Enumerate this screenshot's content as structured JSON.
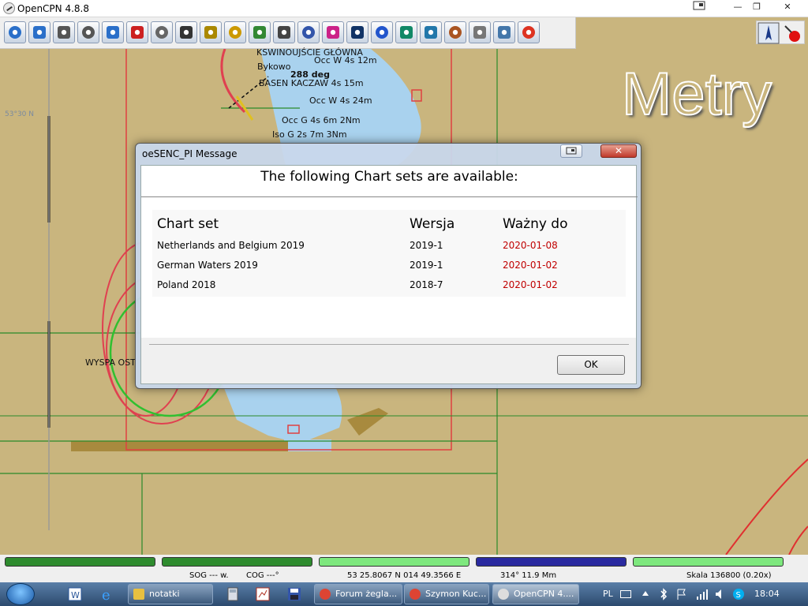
{
  "window": {
    "title": "OpenCPN 4.8.8",
    "min_label": "—",
    "max_label": "❐",
    "close_label": "✕"
  },
  "toolbar": {
    "buttons": [
      {
        "name": "zoom-in-icon",
        "color": "#2a6fc9"
      },
      {
        "name": "zoom-out-icon",
        "color": "#2a6fc9"
      },
      {
        "name": "chart-quilt-down-icon",
        "color": "#555555"
      },
      {
        "name": "chart-quilt-up-icon",
        "color": "#555555"
      },
      {
        "name": "route-icon",
        "color": "#2a6fc9"
      },
      {
        "name": "follow-ship-icon",
        "color": "#cc2020"
      },
      {
        "name": "settings-wrench-icon",
        "color": "#666666"
      },
      {
        "name": "text-toggle-icon",
        "color": "#333333"
      },
      {
        "name": "pencil-mark-icon",
        "color": "#aa8800"
      },
      {
        "name": "tide-current-icon",
        "color": "#cc9900"
      },
      {
        "name": "ais-icon",
        "color": "#338833"
      },
      {
        "name": "print-icon",
        "color": "#444444"
      },
      {
        "name": "route-manager-icon",
        "color": "#3355aa"
      },
      {
        "name": "track-icon",
        "color": "#cc2288"
      },
      {
        "name": "color-scheme-icon",
        "color": "#113366"
      },
      {
        "name": "help-icon",
        "color": "#2255cc"
      },
      {
        "name": "mob-target-icon",
        "color": "#118866"
      },
      {
        "name": "globe-icon",
        "color": "#2277aa"
      },
      {
        "name": "dashboard-icon",
        "color": "#aa5522"
      },
      {
        "name": "plugin-icon",
        "color": "#777777"
      },
      {
        "name": "grib-icon",
        "color": "#4477aa"
      },
      {
        "name": "lifebuoy-icon",
        "color": "#dd3322"
      }
    ]
  },
  "chart": {
    "watermark": "Metry",
    "latitude_label": "53°30 N",
    "labels": [
      {
        "text": "KSWINOUJŚCIE GŁÓWNA"
      },
      {
        "text": "Occ W 4s 12m"
      },
      {
        "text": "Bykowo"
      },
      {
        "text": "288 deg"
      },
      {
        "text": "BASEN KACZAW 4s 15m"
      },
      {
        "text": "Occ W 4s 24m"
      },
      {
        "text": "Occ G 4s 6m 2Nm"
      },
      {
        "text": "Iso G 2s 7m 3Nm"
      },
      {
        "text": "WYSPA OST"
      }
    ]
  },
  "dialog": {
    "title": "oeSENC_PI Message",
    "close_label": "✕",
    "heading": "The following Chart sets are available:",
    "columns": [
      "Chart set",
      "Wersja",
      "Ważny do"
    ],
    "rows": [
      {
        "set": "Netherlands and Belgium 2019",
        "version": "2019-1",
        "valid": "2020-01-08"
      },
      {
        "set": "German Waters 2019",
        "version": "2019-1",
        "valid": "2020-01-02"
      },
      {
        "set": "Poland 2018",
        "version": "2018-7",
        "valid": "2020-01-02"
      }
    ],
    "ok_label": "OK"
  },
  "statusbar": {
    "sog": "SOG --- w.",
    "cog": "COG ---°",
    "position": "53 25.8067 N   014 49.3566 E",
    "bearing": "314°  11.9 Mm",
    "scale": "Skala 136800 (0.20x)",
    "segment_colors": [
      "#2e8b2e",
      "#2e8b2e",
      "#7ee87e",
      "#2a2aa0",
      "#7ee87e"
    ]
  },
  "taskbar": {
    "tasks": [
      {
        "label": "notatki",
        "icon_color": "#e8c040"
      },
      {
        "label": "Forum żegla...",
        "icon_color": "#dd4433"
      },
      {
        "label": "Szymon Kuc...",
        "icon_color": "#dd4433"
      },
      {
        "label": "OpenCPN 4....",
        "icon_color": "#dddddd"
      }
    ],
    "language": "PL",
    "clock": "18:04"
  }
}
